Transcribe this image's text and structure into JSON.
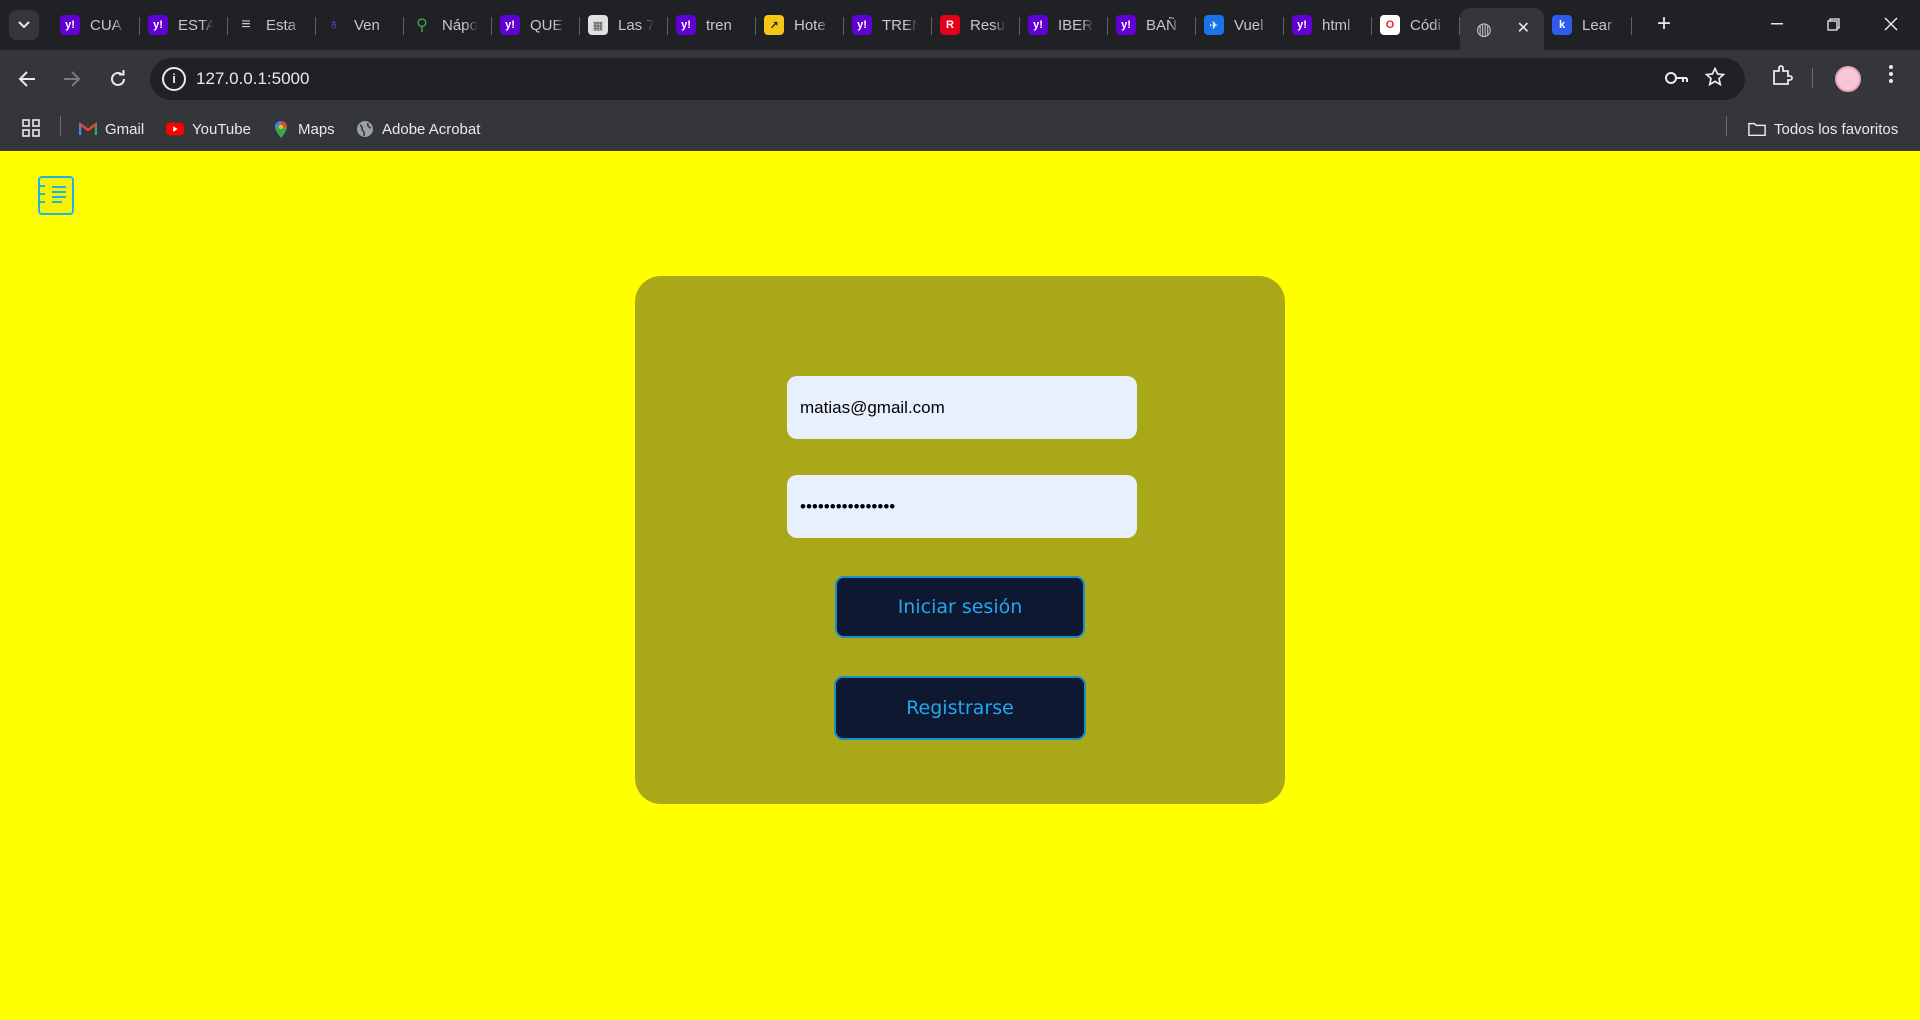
{
  "browser": {
    "tabs": [
      {
        "title": "CUA",
        "icon": "yahoo-icon",
        "color": "#6001d2",
        "glyph": "y!"
      },
      {
        "title": "ESTA",
        "icon": "yahoo-icon",
        "color": "#6001d2",
        "glyph": "y!"
      },
      {
        "title": "Esta",
        "icon": "lines-icon",
        "color": "#202124",
        "glyph": "≡"
      },
      {
        "title": "Ven",
        "icon": "figure-icon",
        "color": "#202124",
        "glyph": "♁"
      },
      {
        "title": "Nápo",
        "icon": "maps-pin-icon",
        "color": "#202124",
        "glyph": "⚲"
      },
      {
        "title": "QUE",
        "icon": "yahoo-icon",
        "color": "#6001d2",
        "glyph": "y!"
      },
      {
        "title": "Las 7",
        "icon": "image-icon",
        "color": "#e0e0e0",
        "glyph": "▦"
      },
      {
        "title": "tren",
        "icon": "yahoo-icon",
        "color": "#6001d2",
        "glyph": "y!"
      },
      {
        "title": "Hote",
        "icon": "hotel-icon",
        "color": "#f5c518",
        "glyph": "↗"
      },
      {
        "title": "TREN",
        "icon": "yahoo-icon",
        "color": "#6001d2",
        "glyph": "y!"
      },
      {
        "title": "Resu",
        "icon": "renfe-icon",
        "color": "#e2001a",
        "glyph": "R"
      },
      {
        "title": "IBER",
        "icon": "yahoo-icon",
        "color": "#6001d2",
        "glyph": "y!"
      },
      {
        "title": "BAÑ",
        "icon": "yahoo-icon",
        "color": "#6001d2",
        "glyph": "y!"
      },
      {
        "title": "Vuel",
        "icon": "flights-icon",
        "color": "#1a73e8",
        "glyph": "✈"
      },
      {
        "title": "html",
        "icon": "yahoo-icon",
        "color": "#6001d2",
        "glyph": "y!"
      },
      {
        "title": "Códi",
        "icon": "opera-icon",
        "color": "#ffffff",
        "glyph": "O"
      },
      {
        "title": "",
        "icon": "globe-icon",
        "color": "#35363a",
        "glyph": "◍",
        "active": true
      },
      {
        "title": "Lear",
        "icon": "k-icon",
        "color": "#2f5bea",
        "glyph": "k"
      }
    ],
    "new_tab_label": "+",
    "url": "127.0.0.1:5000",
    "bookmarks": [
      {
        "label": "Gmail",
        "icon": "gmail-icon"
      },
      {
        "label": "YouTube",
        "icon": "youtube-icon"
      },
      {
        "label": "Maps",
        "icon": "maps-icon"
      },
      {
        "label": "Adobe Acrobat",
        "icon": "globe-icon"
      }
    ],
    "all_bookmarks_label": "Todos los favoritos"
  },
  "login": {
    "email_value": "matias@gmail.com",
    "password_value": "••••••••••••••••",
    "login_button": "Iniciar sesión",
    "register_button": "Registrarse"
  },
  "colors": {
    "page_bg": "#ffff00",
    "card_bg": "#a8a818",
    "button_bg": "#0e1830",
    "button_text": "#20a8f0",
    "input_bg": "#e8f0fe"
  }
}
